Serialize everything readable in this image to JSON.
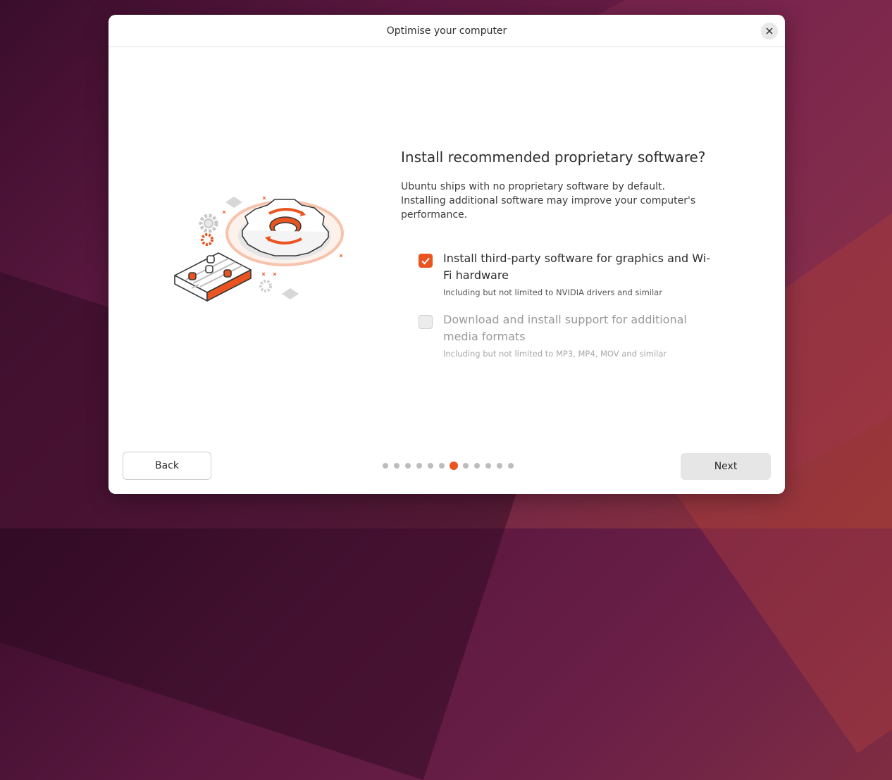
{
  "window": {
    "title": "Optimise your computer"
  },
  "page": {
    "heading": "Install recommended proprietary software?",
    "description": "Ubuntu ships with no proprietary software by default. Installing additional software may improve your computer's performance."
  },
  "options": [
    {
      "label": "Install third-party software for graphics and Wi-Fi hardware",
      "sublabel": "Including but not limited to NVIDIA drivers and similar",
      "checked": true,
      "enabled": true
    },
    {
      "label": "Download and install support for additional media formats",
      "sublabel": "Including but not limited to MP3, MP4, MOV and similar",
      "checked": false,
      "enabled": false
    }
  ],
  "footer": {
    "back_label": "Back",
    "next_label": "Next",
    "progress": {
      "total_steps": 12,
      "current_step": 7
    }
  },
  "colors": {
    "accent": "#e95420",
    "window_bg": "#ffffff"
  },
  "icons": {
    "close": "close-icon",
    "check": "checkmark-icon"
  }
}
